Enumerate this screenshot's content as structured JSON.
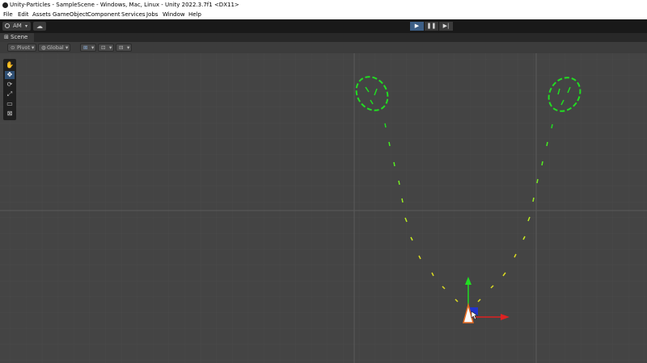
{
  "window": {
    "title": "Unity-Particles - SampleScene - Windows, Mac, Linux - Unity 2022.3.7f1 <DX11>"
  },
  "menu": [
    "File",
    "Edit",
    "Assets",
    "GameObject",
    "Component",
    "Services",
    "Jobs",
    "Window",
    "Help"
  ],
  "toolbar": {
    "account_label": "AM",
    "account_chevron": "▾",
    "cloud_icon": "☁",
    "play_icon": "▶",
    "pause_icon": "❚❚",
    "step_icon": "▶|"
  },
  "scene_tab": {
    "icon": "⊞",
    "label": "Scene"
  },
  "scene_toolbar": {
    "pivot_label": "Pivot",
    "global_label": "Global"
  },
  "tools": [
    "hand-tool",
    "move-tool",
    "rotate-tool",
    "scale-tool",
    "rect-tool",
    "transform-tool"
  ],
  "tool_glyphs": [
    "✋",
    "✥",
    "⟳",
    "⤢",
    "▭",
    "⊠"
  ],
  "colors": {
    "accent": "#3d5f86",
    "particle_green": "#22dd22",
    "particle_yellow": "#dddd22",
    "gizmo_y": "#22dd22",
    "gizmo_x": "#dd2222",
    "gizmo_z": "#2233cc",
    "emitter": "#e86a1f"
  }
}
